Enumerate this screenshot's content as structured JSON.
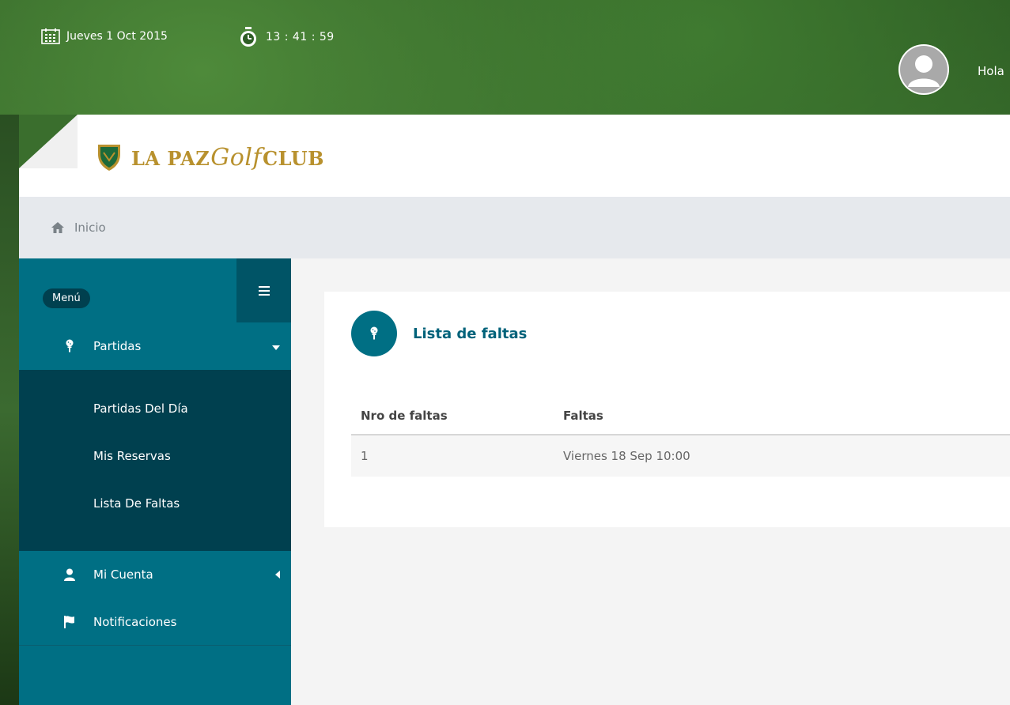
{
  "topbar": {
    "date": "Jueves 1 Oct 2015",
    "time": "13 : 41 : 59",
    "greeting": "Hola"
  },
  "header": {
    "logo_prefix": "LA PAZ",
    "logo_script": "Golf",
    "logo_suffix": "CLUB",
    "brand_color": "#b8912e"
  },
  "breadcrumb": {
    "home_label": "Inicio"
  },
  "sidebar": {
    "menu_label": "Menú",
    "items": [
      {
        "label": "Partidas",
        "icon": "golf-tee-icon",
        "caret": "down"
      },
      {
        "label": "Mi Cuenta",
        "icon": "user-icon",
        "caret": "left"
      },
      {
        "label": "Notificaciones",
        "icon": "flag-icon",
        "caret": ""
      }
    ],
    "subitems": [
      {
        "label": "Partidas Del Día"
      },
      {
        "label": "Mis Reservas"
      },
      {
        "label": "Lista De Faltas"
      }
    ],
    "colors": {
      "primary": "#006f84",
      "dark": "#00404f"
    }
  },
  "main": {
    "title": "Lista de faltas",
    "table": {
      "headers": [
        "Nro de faltas",
        "Faltas"
      ],
      "rows": [
        [
          "1",
          "Viernes 18 Sep 10:00"
        ]
      ]
    }
  }
}
